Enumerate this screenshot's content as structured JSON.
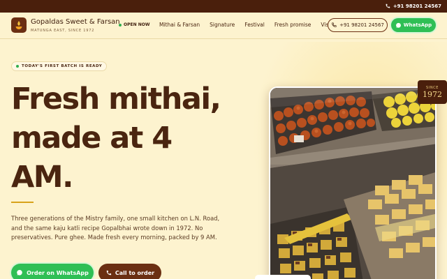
{
  "topbar": {
    "phone": "+91 98201 24567"
  },
  "brand": {
    "name": "Gopaldas Sweet & Farsan",
    "tagline": "MATUNGA EAST, SINCE 1972"
  },
  "nav": {
    "status": "OPEN NOW",
    "links": [
      "Mithai & Farsan",
      "Signature",
      "Festival",
      "Fresh promise",
      "Visit"
    ],
    "call_label": "+91 98201 24567",
    "whatsapp_label": "WhatsApp"
  },
  "hero": {
    "badge": "TODAY'S FIRST BATCH IS READY",
    "headline": "Fresh mithai, made at 4 AM.",
    "intro": "Three generations of the Mistry family, one small kitchen on L.N. Road, and the same kaju katli recipe Gopalbhai wrote down in 1972. No preservatives. Pure ghee. Made fresh every morning, packed by 9 AM.",
    "primary_cta": "Order on WhatsApp",
    "secondary_cta": "Call to order",
    "since_label": "SINCE",
    "since_year": "1972"
  },
  "colors": {
    "background": "#fdf3cf",
    "dark_brown": "#4a1f0c",
    "whatsapp_green": "#2fbf55",
    "gold": "#d8a21a"
  }
}
